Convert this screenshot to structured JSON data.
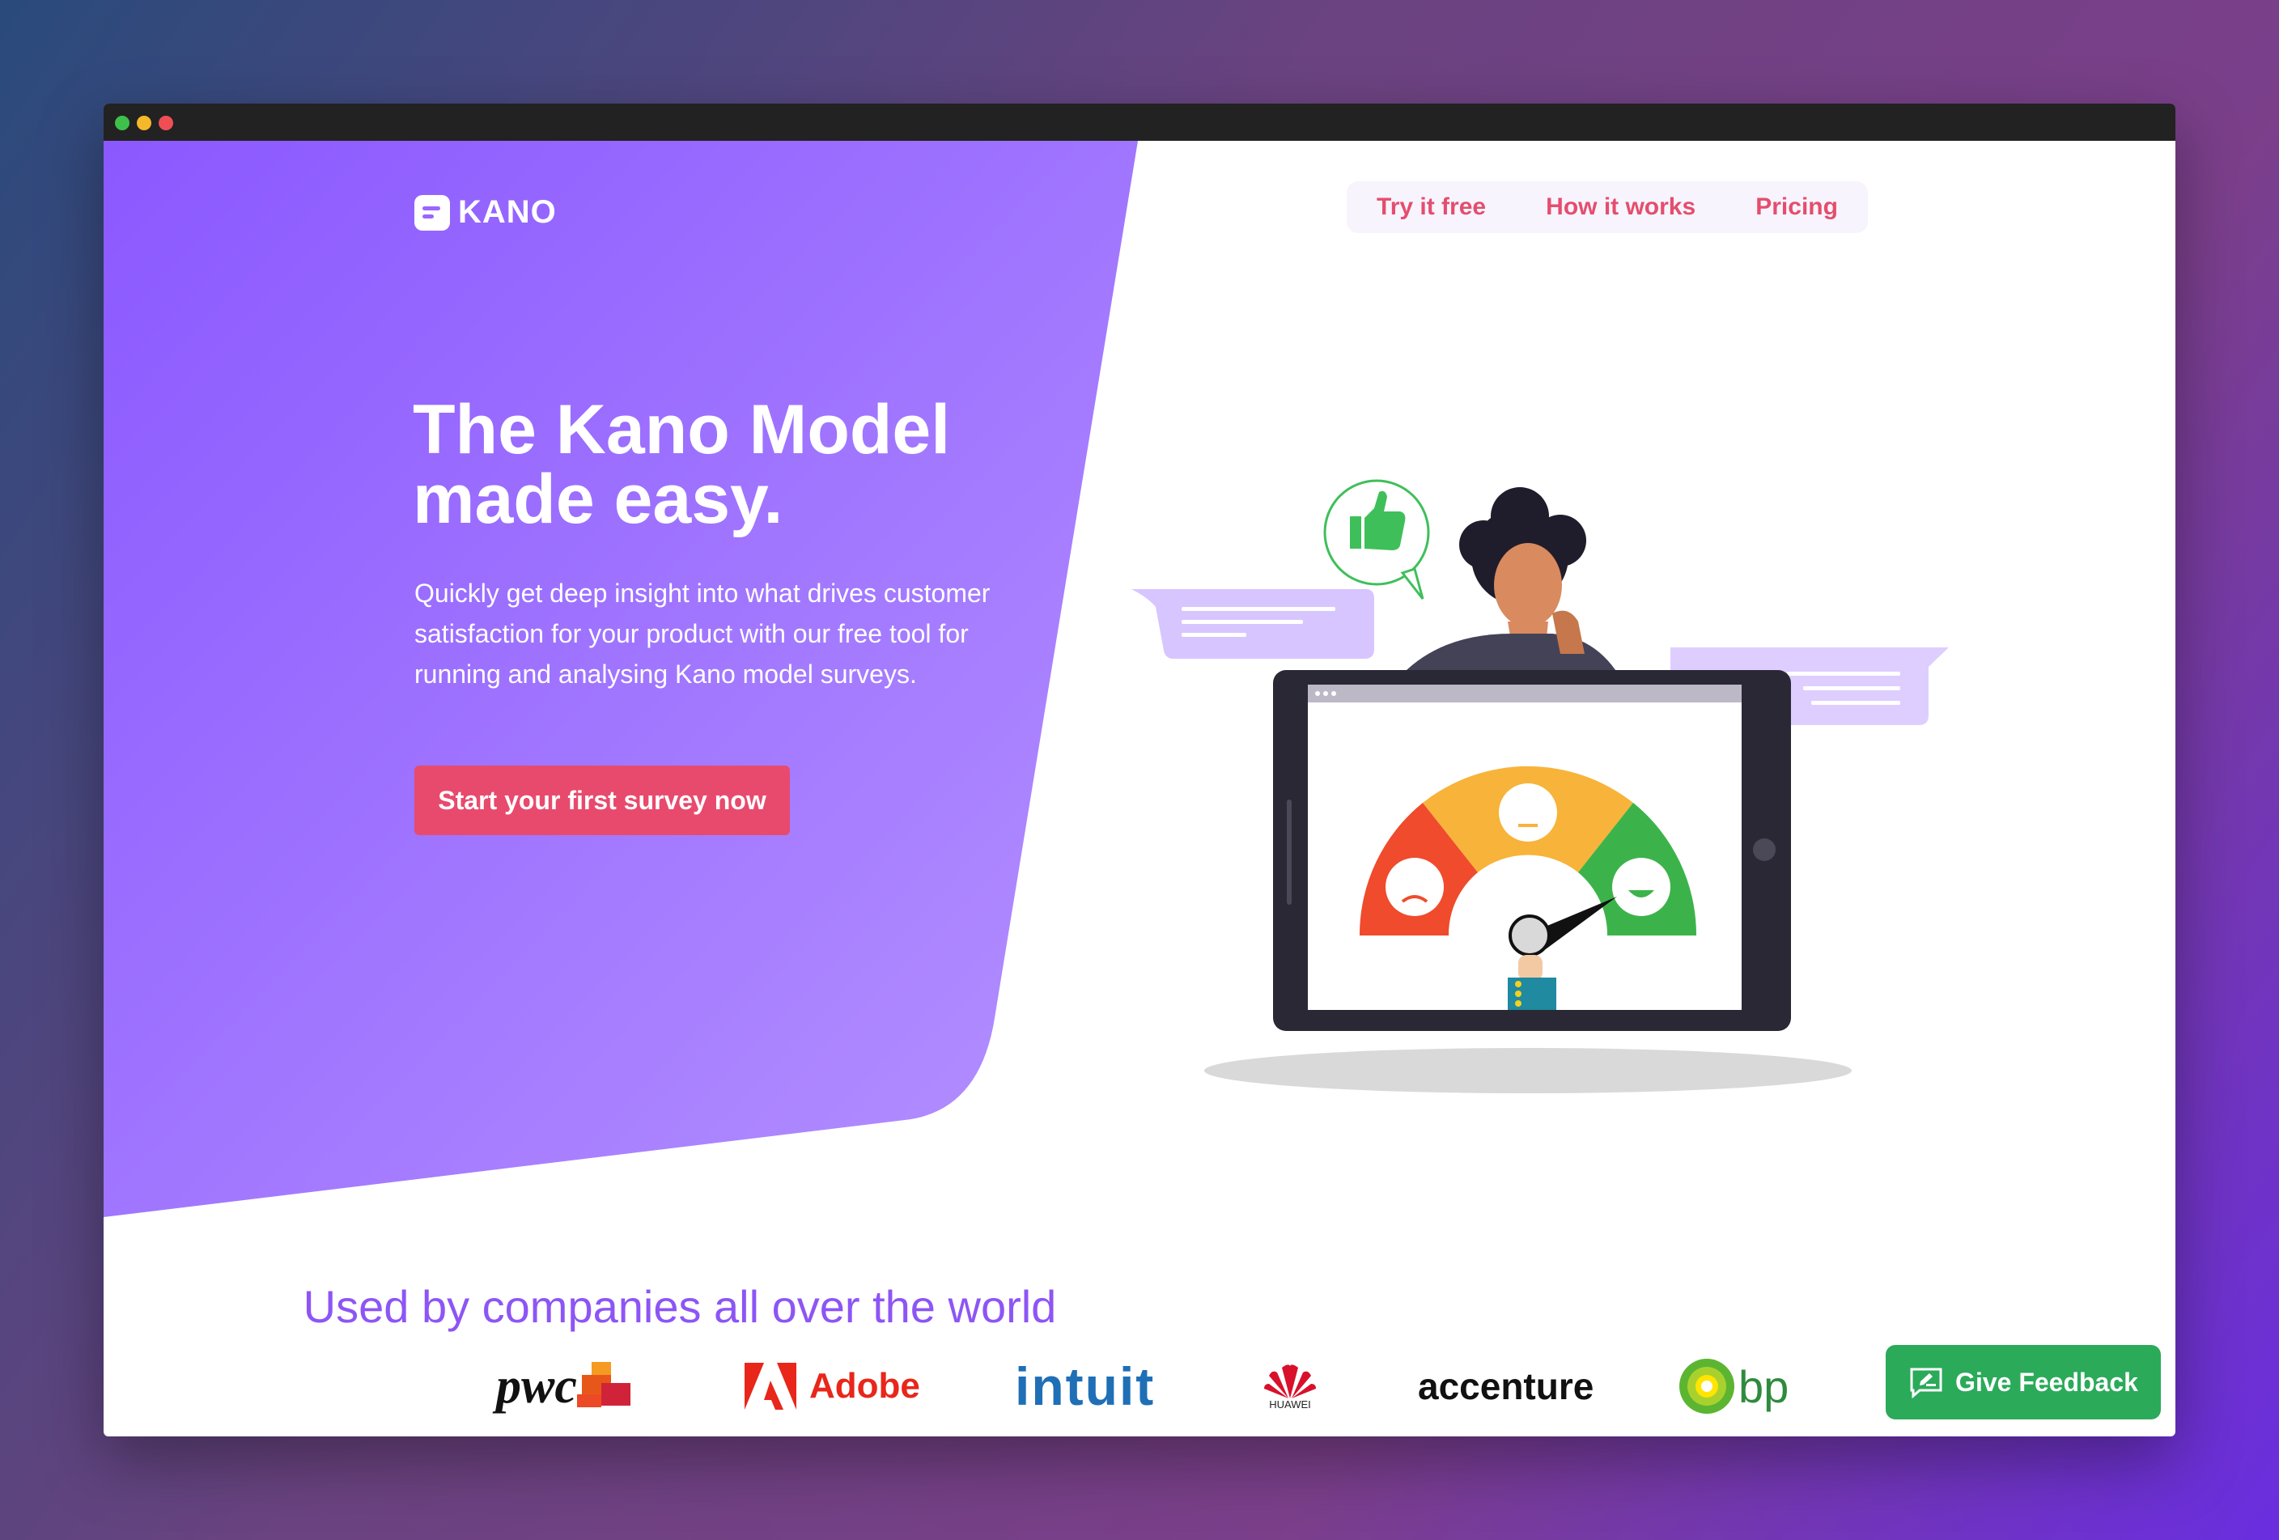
{
  "window": {
    "controls": [
      "green-dot",
      "yellow-dot",
      "red-dot"
    ]
  },
  "brand": {
    "name": "KANO",
    "icon": "kano-logo-icon"
  },
  "nav": {
    "items": [
      {
        "label": "Try it free"
      },
      {
        "label": "How it works"
      },
      {
        "label": "Pricing"
      }
    ]
  },
  "hero": {
    "headline_line1": "The Kano Model",
    "headline_line2": "made easy.",
    "subtext": "Quickly get deep insight into what drives customer satisfaction for your product with our free tool for running and analysing Kano model surveys.",
    "cta_label": "Start your first survey now"
  },
  "companies": {
    "heading": "Used by companies all over the world",
    "logos": [
      {
        "name": "pwc"
      },
      {
        "name": "Adobe"
      },
      {
        "name": "intuit"
      },
      {
        "name": "HUAWEI"
      },
      {
        "name": "accenture"
      },
      {
        "name": "bp"
      }
    ]
  },
  "feedback": {
    "label": "Give Feedback",
    "icon": "feedback-pencil-icon"
  },
  "colors": {
    "accent_purple": "#9a66ff",
    "cta_pink": "#e84a6d",
    "nav_text": "#e44e6e",
    "feedback_green": "#2baa5a",
    "heading_purple": "#8d55f5"
  }
}
